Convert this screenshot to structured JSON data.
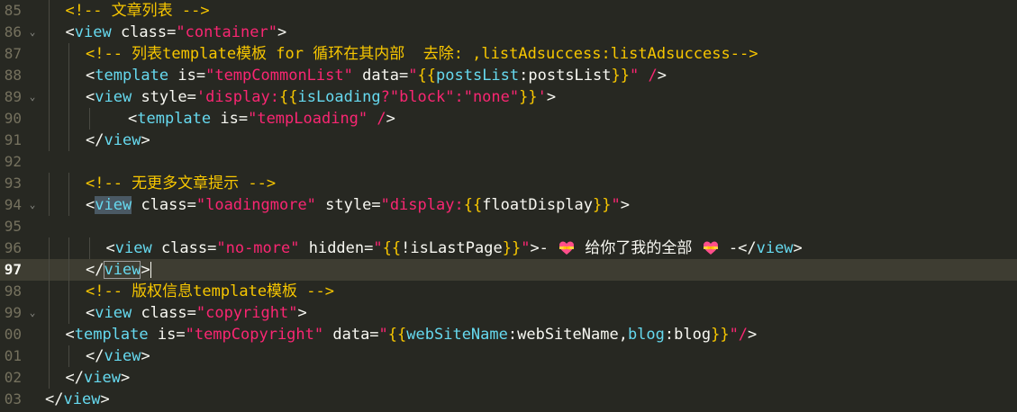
{
  "editor": {
    "lines": [
      {
        "num": "85",
        "fold": false,
        "active": false,
        "tokens": [
          {
            "c": "cmt",
            "t": "<!-- 文章列表 -->"
          }
        ]
      },
      {
        "num": "86",
        "fold": true,
        "active": false,
        "tokens": [
          {
            "c": "pun",
            "t": "<"
          },
          {
            "c": "tag",
            "t": "view"
          },
          {
            "c": "attr",
            "t": " class="
          },
          {
            "c": "str",
            "t": "\"container\""
          },
          {
            "c": "pun",
            "t": ">"
          }
        ]
      },
      {
        "num": "87",
        "fold": false,
        "active": false,
        "tokens": [
          {
            "c": "cmt",
            "t": "<!-- 列表template模板 for 循环在其内部  去除: ,listAdsuccess:listAdsuccess-->"
          }
        ]
      },
      {
        "num": "88",
        "fold": false,
        "active": false,
        "tokens": [
          {
            "c": "pun",
            "t": "<"
          },
          {
            "c": "tag",
            "t": "template"
          },
          {
            "c": "attr",
            "t": " is="
          },
          {
            "c": "str",
            "t": "\"tempCommonList\""
          },
          {
            "c": "attr",
            "t": " data="
          },
          {
            "c": "str",
            "t": "\""
          },
          {
            "c": "br",
            "t": "{{"
          },
          {
            "c": "tag",
            "t": "postsList"
          },
          {
            "c": "txt",
            "t": ":postsList"
          },
          {
            "c": "br",
            "t": "}}"
          },
          {
            "c": "str",
            "t": "\""
          },
          {
            "c": "pun",
            "t": " "
          },
          {
            "c": "str",
            "t": "/"
          },
          {
            "c": "pun",
            "t": ">"
          }
        ]
      },
      {
        "num": "89",
        "fold": true,
        "active": false,
        "tokens": [
          {
            "c": "pun",
            "t": "<"
          },
          {
            "c": "tag",
            "t": "view"
          },
          {
            "c": "attr",
            "t": " style="
          },
          {
            "c": "str",
            "t": "'display:"
          },
          {
            "c": "br",
            "t": "{{"
          },
          {
            "c": "tag",
            "t": "isLoading"
          },
          {
            "c": "str",
            "t": "?\"block\":\"none\""
          },
          {
            "c": "br",
            "t": "}}"
          },
          {
            "c": "str",
            "t": "'"
          },
          {
            "c": "pun",
            "t": ">"
          }
        ]
      },
      {
        "num": "90",
        "fold": false,
        "active": false,
        "tokens": [
          {
            "c": "pun",
            "t": "<"
          },
          {
            "c": "tag",
            "t": "template"
          },
          {
            "c": "attr",
            "t": " is="
          },
          {
            "c": "str",
            "t": "\"tempLoading\""
          },
          {
            "c": "pun",
            "t": " "
          },
          {
            "c": "str",
            "t": "/"
          },
          {
            "c": "pun",
            "t": ">"
          }
        ]
      },
      {
        "num": "91",
        "fold": false,
        "active": false,
        "tokens": [
          {
            "c": "pun",
            "t": "</"
          },
          {
            "c": "tag",
            "t": "view"
          },
          {
            "c": "pun",
            "t": ">"
          }
        ]
      },
      {
        "num": "92",
        "fold": false,
        "active": false,
        "tokens": []
      },
      {
        "num": "93",
        "fold": false,
        "active": false,
        "tokens": [
          {
            "c": "cmt",
            "t": "<!-- 无更多文章提示 -->"
          }
        ]
      },
      {
        "num": "94",
        "fold": true,
        "active": false,
        "tokens": [
          {
            "c": "pun",
            "t": "<"
          },
          {
            "c": "hl",
            "t": "view"
          },
          {
            "c": "attr",
            "t": " class="
          },
          {
            "c": "str",
            "t": "\"loadingmore\""
          },
          {
            "c": "attr",
            "t": " style="
          },
          {
            "c": "str",
            "t": "\"display:"
          },
          {
            "c": "br",
            "t": "{{"
          },
          {
            "c": "txt",
            "t": "floatDisplay"
          },
          {
            "c": "br",
            "t": "}}"
          },
          {
            "c": "str",
            "t": "\""
          },
          {
            "c": "pun",
            "t": ">"
          }
        ]
      },
      {
        "num": "95",
        "fold": false,
        "active": false,
        "tokens": []
      },
      {
        "num": "96",
        "fold": false,
        "active": false,
        "tokens": [
          {
            "c": "pun",
            "t": "<"
          },
          {
            "c": "tag",
            "t": "view"
          },
          {
            "c": "attr",
            "t": " class="
          },
          {
            "c": "str",
            "t": "\"no-more\""
          },
          {
            "c": "attr",
            "t": " hidden="
          },
          {
            "c": "str",
            "t": "\""
          },
          {
            "c": "br",
            "t": "{{"
          },
          {
            "c": "txt",
            "t": "!isLastPage"
          },
          {
            "c": "br",
            "t": "}}"
          },
          {
            "c": "str",
            "t": "\""
          },
          {
            "c": "pun",
            "t": ">- "
          },
          {
            "c": "emoji",
            "t": "heart-with-ribbon"
          },
          {
            "c": "txt",
            "t": " 给你了我的全部 "
          },
          {
            "c": "emoji",
            "t": "heart-with-ribbon"
          },
          {
            "c": "pun",
            "t": " -</"
          },
          {
            "c": "tag",
            "t": "view"
          },
          {
            "c": "pun",
            "t": ">"
          }
        ]
      },
      {
        "num": "97",
        "fold": false,
        "active": true,
        "tokens": [
          {
            "c": "pun",
            "t": "</"
          },
          {
            "c": "box",
            "t": "view"
          },
          {
            "c": "pun",
            "t": ">"
          },
          {
            "c": "caret",
            "t": ""
          }
        ]
      },
      {
        "num": "98",
        "fold": false,
        "active": false,
        "tokens": [
          {
            "c": "cmt",
            "t": "<!-- 版权信息template模板 -->"
          }
        ]
      },
      {
        "num": "99",
        "fold": true,
        "active": false,
        "tokens": [
          {
            "c": "pun",
            "t": "<"
          },
          {
            "c": "tag",
            "t": "view"
          },
          {
            "c": "attr",
            "t": " class="
          },
          {
            "c": "str",
            "t": "\"copyright\""
          },
          {
            "c": "pun",
            "t": ">"
          }
        ]
      },
      {
        "num": "00",
        "fold": false,
        "active": false,
        "tokens": [
          {
            "c": "pun",
            "t": "<"
          },
          {
            "c": "tag",
            "t": "template"
          },
          {
            "c": "attr",
            "t": " is="
          },
          {
            "c": "str",
            "t": "\"tempCopyright\""
          },
          {
            "c": "attr",
            "t": " data="
          },
          {
            "c": "str",
            "t": "\""
          },
          {
            "c": "br",
            "t": "{{"
          },
          {
            "c": "tag",
            "t": "webSiteName"
          },
          {
            "c": "txt",
            "t": ":webSiteName,"
          },
          {
            "c": "tag",
            "t": "blog"
          },
          {
            "c": "txt",
            "t": ":blog"
          },
          {
            "c": "br",
            "t": "}}"
          },
          {
            "c": "str",
            "t": "\"/"
          },
          {
            "c": "pun",
            "t": ">"
          }
        ]
      },
      {
        "num": "01",
        "fold": false,
        "active": false,
        "tokens": [
          {
            "c": "pun",
            "t": "</"
          },
          {
            "c": "tag",
            "t": "view"
          },
          {
            "c": "pun",
            "t": ">"
          }
        ]
      },
      {
        "num": "02",
        "fold": false,
        "active": false,
        "tokens": [
          {
            "c": "pun",
            "t": "</"
          },
          {
            "c": "tag",
            "t": "view"
          },
          {
            "c": "pun",
            "t": ">"
          }
        ]
      },
      {
        "num": "03",
        "fold": false,
        "active": false,
        "tokens": [
          {
            "c": "pun",
            "t": "</"
          },
          {
            "c": "tag",
            "t": "view"
          },
          {
            "c": "pun",
            "t": ">"
          }
        ]
      }
    ],
    "colors": {
      "background": "#272822",
      "active_line": "#3e3d32",
      "comment": "#f7c600",
      "tag": "#66d9ef",
      "string": "#f92672",
      "brace": "#f7c600",
      "text": "#f8f8f2",
      "line_number": "#75715e"
    }
  }
}
